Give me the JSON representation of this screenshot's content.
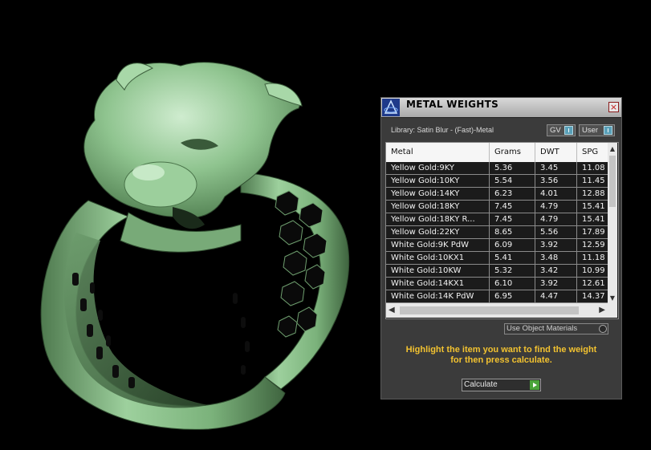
{
  "colors": {
    "background": "#000000",
    "model_green": "#86bf86",
    "panel_bg": "#3b3b3b",
    "hint_text": "#f2c230",
    "row_bg": "#1b1b1b"
  },
  "viewport": {
    "subject": "jewelry-3d-model"
  },
  "dialog": {
    "title": "METAL WEIGHTS",
    "close_label": "×",
    "library_label": "Library: Satin Blur - (Fast)-Metal",
    "toggles": [
      {
        "label": "GV"
      },
      {
        "label": "User"
      }
    ],
    "table": {
      "columns": [
        "Metal",
        "Grams",
        "DWT",
        "SPG"
      ],
      "rows": [
        [
          "Yellow Gold:9KY",
          "5.36",
          "3.45",
          "11.08"
        ],
        [
          "Yellow Gold:10KY",
          "5.54",
          "3.56",
          "11.45"
        ],
        [
          "Yellow Gold:14KY",
          "6.23",
          "4.01",
          "12.88"
        ],
        [
          "Yellow Gold:18KY",
          "7.45",
          "4.79",
          "15.41"
        ],
        [
          "Yellow Gold:18KY R...",
          "7.45",
          "4.79",
          "15.41"
        ],
        [
          "Yellow Gold:22KY",
          "8.65",
          "5.56",
          "17.89"
        ],
        [
          "White Gold:9K PdW",
          "6.09",
          "3.92",
          "12.59"
        ],
        [
          "White Gold:10KX1",
          "5.41",
          "3.48",
          "11.18"
        ],
        [
          "White Gold:10KW",
          "5.32",
          "3.42",
          "10.99"
        ],
        [
          "White Gold:14KX1",
          "6.10",
          "3.92",
          "12.61"
        ],
        [
          "White Gold:14K PdW",
          "6.95",
          "4.47",
          "14.37"
        ]
      ]
    },
    "use_object_materials_label": "Use Object Materials",
    "hint_line1": "Highlight the item you want to find the weight",
    "hint_line2": "for then press calculate.",
    "calculate_label": "Calculate"
  }
}
